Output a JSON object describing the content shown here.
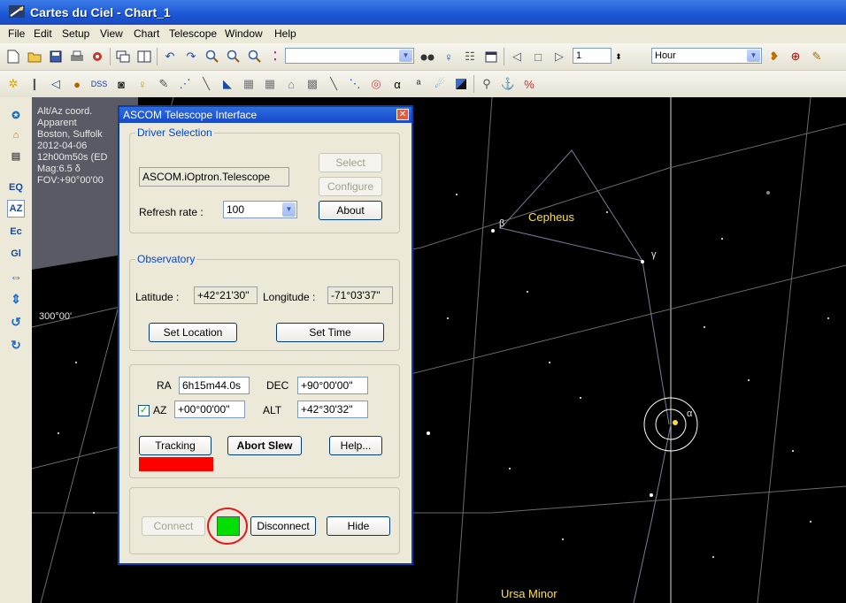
{
  "window": {
    "title": "Cartes du Ciel - Chart_1"
  },
  "menu": [
    "File",
    "Edit",
    "Setup",
    "View",
    "Chart",
    "Telescope",
    "Window",
    "Help"
  ],
  "toolbar": {
    "step_value": "1",
    "unit_value": "Hour",
    "dss_label": "DSS",
    "alpha_label": "α"
  },
  "leftbar": {
    "eq_label": "EQ",
    "az_label": "AZ",
    "ec_label": "Ec",
    "gl_label": "Gl"
  },
  "info": {
    "line1": "Alt/Az coord.",
    "line2": "Apparent",
    "line3": "Boston, Suffolk",
    "line4": "2012-04-06",
    "line5": "12h00m50s (ED",
    "line6": "Mag:6.5   δ",
    "line7": "FOV:+90°00'00"
  },
  "sky": {
    "cepheus": "Cepheus",
    "ursa_minor": "Ursa Minor",
    "azimuth": "300°00'",
    "beta": "β",
    "gamma": "γ",
    "alpha": "α"
  },
  "dialog": {
    "title": "ASCOM Telescope Interface",
    "driver": {
      "group_label": "Driver Selection",
      "driver_name": "ASCOM.iOptron.Telescope",
      "select_label": "Select",
      "configure_label": "Configure",
      "about_label": "About",
      "refresh_label": "Refresh rate :",
      "refresh_value": "100"
    },
    "observatory": {
      "group_label": "Observatory",
      "latitude_label": "Latitude :",
      "latitude_value": "+42°21'30''",
      "longitude_label": "Longitude :",
      "longitude_value": "-71°03'37''",
      "set_location_label": "Set Location",
      "set_time_label": "Set Time"
    },
    "coords": {
      "ra_label": "RA",
      "ra_value": "6h15m44.0s",
      "dec_label": "DEC",
      "dec_value": "+90°00'00''",
      "az_label": "AZ",
      "az_value": "+00°00'00''",
      "alt_label": "ALT",
      "alt_value": "+42°30'32''",
      "tracking_label": "Tracking",
      "abort_label": "Abort Slew",
      "help_label": "Help..."
    },
    "connection": {
      "connect_label": "Connect",
      "disconnect_label": "Disconnect",
      "hide_label": "Hide",
      "status_color": "#00e000"
    },
    "tracking_color": "#ff0000"
  }
}
